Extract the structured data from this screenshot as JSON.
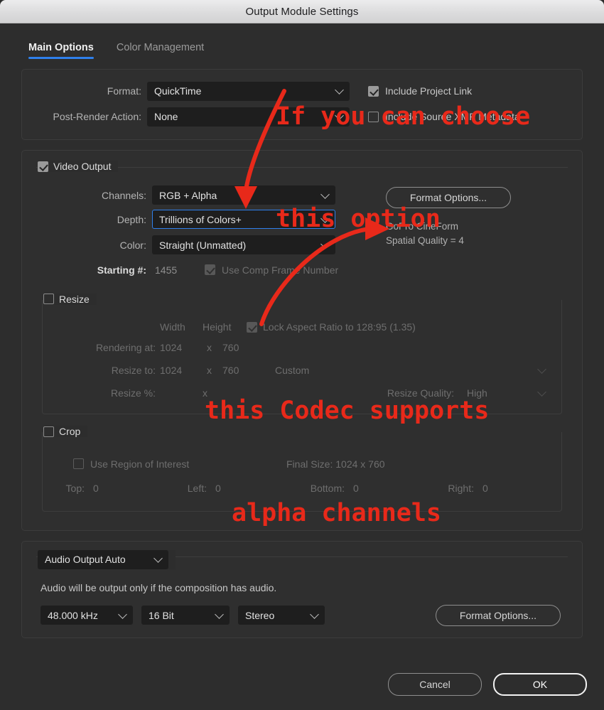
{
  "window": {
    "title": "Output Module Settings"
  },
  "tabs": [
    {
      "label": "Main Options",
      "active": true
    },
    {
      "label": "Color Management",
      "active": false
    }
  ],
  "format_panel": {
    "format_label": "Format:",
    "format_value": "QuickTime",
    "post_render_label": "Post-Render Action:",
    "post_render_value": "None",
    "include_project_link": {
      "label": "Include Project Link",
      "checked": true
    },
    "include_xmp": {
      "label": "Include Source XMP Metadata",
      "checked": false
    }
  },
  "video_output": {
    "group_label": "Video Output",
    "group_checked": true,
    "channels_label": "Channels:",
    "channels_value": "RGB + Alpha",
    "depth_label": "Depth:",
    "depth_value": "Trillions of Colors+",
    "color_label": "Color:",
    "color_value": "Straight (Unmatted)",
    "starting_label": "Starting #:",
    "starting_value": "1455",
    "use_comp_frame": {
      "label": "Use Comp Frame Number",
      "checked": true
    },
    "format_options_button": "Format Options...",
    "codec_name": "GoPro CineForm",
    "codec_quality": "Spatial Quality = 4"
  },
  "resize": {
    "group_label": "Resize",
    "group_checked": false,
    "width_header": "Width",
    "height_header": "Height",
    "lock_aspect": {
      "label": "Lock Aspect Ratio to 128:95 (1.35)",
      "checked": true
    },
    "rendering_at_label": "Rendering at:",
    "rendering_width": "1024",
    "rendering_x": "x",
    "rendering_height": "760",
    "resize_to_label": "Resize to:",
    "resize_width": "1024",
    "resize_x": "x",
    "resize_height": "760",
    "resize_preset": "Custom",
    "resize_pct_label": "Resize %:",
    "resize_pct_x": "x",
    "resize_quality_label": "Resize Quality:",
    "resize_quality_value": "High"
  },
  "crop": {
    "group_label": "Crop",
    "group_checked": false,
    "use_region": {
      "label": "Use Region of Interest",
      "checked": false
    },
    "final_size": "Final Size: 1024 x 760",
    "top_label": "Top:",
    "top_value": "0",
    "left_label": "Left:",
    "left_value": "0",
    "bottom_label": "Bottom:",
    "bottom_value": "0",
    "right_label": "Right:",
    "right_value": "0"
  },
  "audio": {
    "output_mode": "Audio Output Auto",
    "note": "Audio will be output only if the composition has audio.",
    "sample_rate": "48.000 kHz",
    "bit_depth": "16 Bit",
    "channels": "Stereo",
    "format_options_button": "Format Options..."
  },
  "footer": {
    "cancel_label": "Cancel",
    "ok_label": "OK"
  },
  "annotations": {
    "color": "#e8291a",
    "note1_line1": "If you can choose",
    "note1_line2": "this option",
    "note2_line1": "this Codec supports",
    "note2_line2": "alpha channels"
  }
}
